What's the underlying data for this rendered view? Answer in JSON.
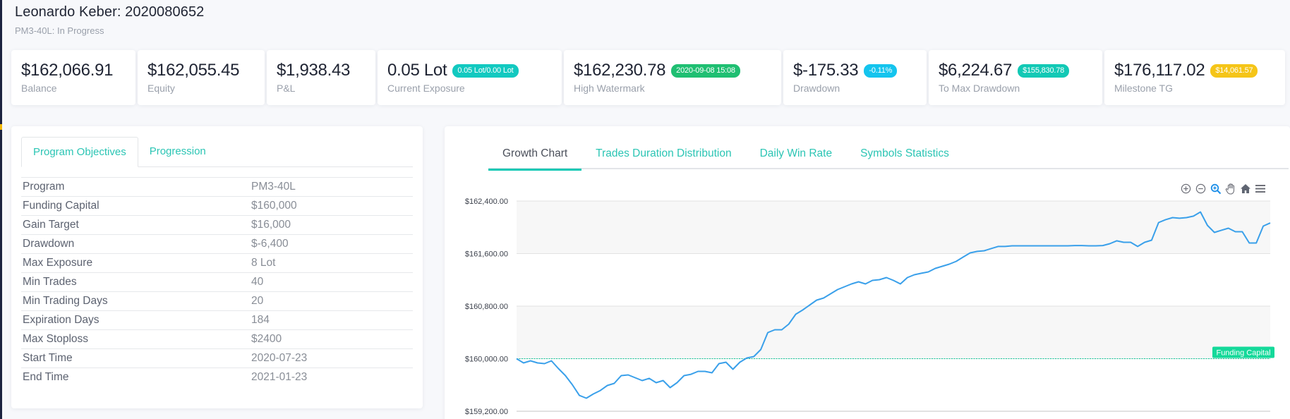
{
  "header": {
    "title": "Leonardo Keber: 2020080652",
    "subtitle": "PM3-40L: In Progress"
  },
  "stats": [
    {
      "value": "$162,066.91",
      "label": "Balance",
      "badge": null
    },
    {
      "value": "$162,055.45",
      "label": "Equity",
      "badge": null
    },
    {
      "value": "$1,938.43",
      "label": "P&L",
      "badge": null
    },
    {
      "value": "0.05 Lot",
      "label": "Current Exposure",
      "badge": "0.05 Lot/0.00 Lot",
      "badge_color": "#12c9c0"
    },
    {
      "value": "$162,230.78",
      "label": "High Watermark",
      "badge": "2020-09-08 15:08",
      "badge_color": "#1fbf72"
    },
    {
      "value": "$-175.33",
      "label": "Drawdown",
      "badge": "-0.11%",
      "badge_color": "#14c4ee"
    },
    {
      "value": "$6,224.67",
      "label": "To Max Drawdown",
      "badge": "$155,830.78",
      "badge_color": "#12c9b5"
    },
    {
      "value": "$176,117.02",
      "label": "Milestone TG",
      "badge": "$14,061.57",
      "badge_color": "#f5c518"
    }
  ],
  "objectives": {
    "tabs": [
      {
        "label": "Program Objectives",
        "active": true
      },
      {
        "label": "Progression",
        "active": false
      }
    ],
    "rows": [
      {
        "key": "Program",
        "value": "PM3-40L"
      },
      {
        "key": "Funding Capital",
        "value": "$160,000"
      },
      {
        "key": "Gain Target",
        "value": "$16,000"
      },
      {
        "key": "Drawdown",
        "value": "$-6,400"
      },
      {
        "key": "Max Exposure",
        "value": "8 Lot"
      },
      {
        "key": "Min Trades",
        "value": "40"
      },
      {
        "key": "Min Trading Days",
        "value": "20"
      },
      {
        "key": "Expiration Days",
        "value": "184"
      },
      {
        "key": "Max Stoploss",
        "value": "$2400"
      },
      {
        "key": "Start Time",
        "value": "2020-07-23"
      },
      {
        "key": "End Time",
        "value": "2021-01-23"
      }
    ]
  },
  "chart_panel": {
    "tabs": [
      {
        "label": "Growth Chart",
        "active": true
      },
      {
        "label": "Trades Duration Distribution",
        "active": false
      },
      {
        "label": "Daily Win Rate",
        "active": false
      },
      {
        "label": "Symbols Statistics",
        "active": false
      }
    ],
    "toolbar": [
      {
        "icon": "zoom-in-icon"
      },
      {
        "icon": "zoom-out-icon"
      },
      {
        "icon": "selection-zoom-icon"
      },
      {
        "icon": "pan-hand-icon"
      },
      {
        "icon": "reset-home-icon"
      },
      {
        "icon": "menu-icon"
      }
    ]
  },
  "colors": {
    "accent": "#12c9b5",
    "line": "#3aa0ea",
    "funding_line": "#14c99a",
    "funding_label_bg": "#14d99a"
  },
  "chart_data": {
    "type": "line",
    "title": "Growth Chart",
    "xlabel": "",
    "ylabel": "",
    "ylim": [
      159200,
      162400
    ],
    "yticks": [
      162400,
      161600,
      160800,
      160000,
      159200
    ],
    "ytick_labels": [
      "$162,400.00",
      "$161,600.00",
      "$160,800.00",
      "$160,000.00",
      "$159,200.00"
    ],
    "grid": true,
    "annotations": [
      {
        "type": "hline",
        "y": 160000,
        "label": "Funding Capital"
      }
    ],
    "series": [
      {
        "name": "Balance",
        "values": [
          160000,
          159936,
          159968,
          159936,
          159925,
          159968,
          159850,
          159742,
          159603,
          159441,
          159399,
          159463,
          159516,
          159592,
          159624,
          159742,
          159753,
          159710,
          159667,
          159700,
          159635,
          159667,
          159560,
          159635,
          159742,
          159763,
          159807,
          159807,
          159785,
          159925,
          159946,
          159839,
          159946,
          160011,
          160032,
          160140,
          160397,
          160440,
          160440,
          160526,
          160677,
          160741,
          160816,
          160891,
          160923,
          160988,
          161052,
          161095,
          161138,
          161170,
          161138,
          161192,
          161203,
          161235,
          161192,
          161138,
          161235,
          161278,
          161300,
          161321,
          161375,
          161407,
          161439,
          161482,
          161547,
          161611,
          161633,
          161643,
          161676,
          161708,
          161708,
          161718,
          161718,
          161718,
          161718,
          161718,
          161718,
          161718,
          161718,
          161718,
          161722,
          161722,
          161718,
          161718,
          161722,
          161750,
          161794,
          161772,
          161772,
          161708,
          161772,
          161804,
          162073,
          162116,
          162148,
          162138,
          162148,
          162170,
          162234,
          162030,
          161922,
          161955,
          161987,
          161933,
          161933,
          161761,
          161761,
          162019,
          162066
        ]
      }
    ]
  }
}
